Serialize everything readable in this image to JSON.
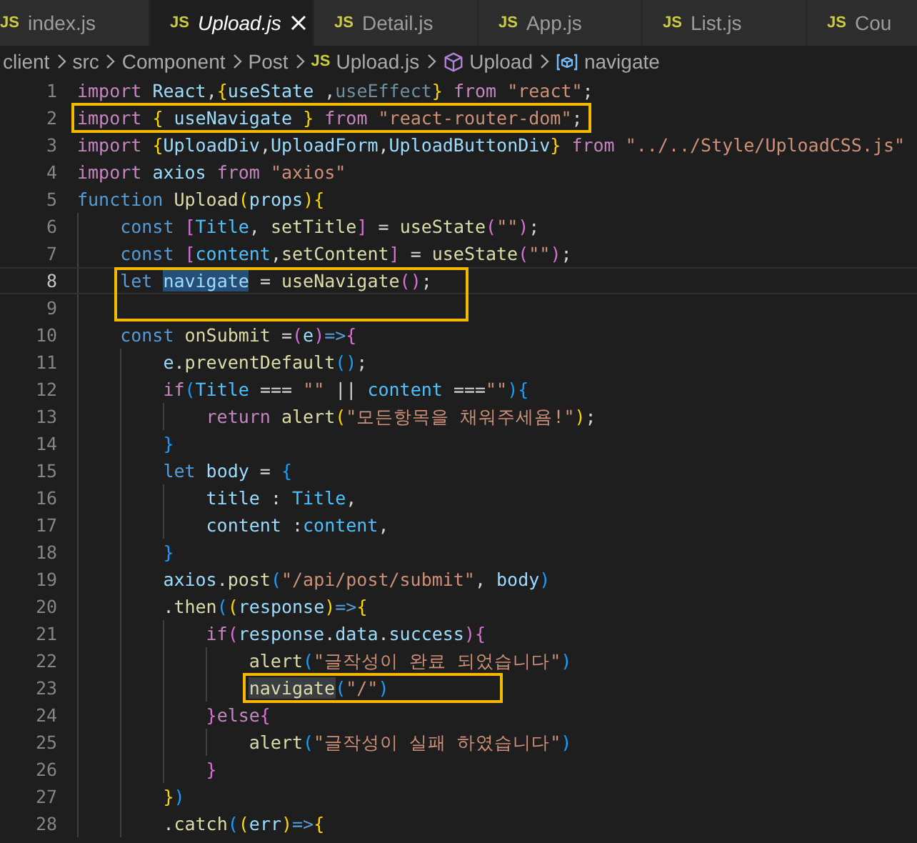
{
  "tabs": [
    {
      "icon": "JS",
      "label": "index.js",
      "selected": false,
      "preview": false
    },
    {
      "icon": "JS",
      "label": "Upload.js",
      "selected": true,
      "preview": true
    },
    {
      "icon": "JS",
      "label": "Detail.js",
      "selected": false,
      "preview": false
    },
    {
      "icon": "JS",
      "label": "App.js",
      "selected": false,
      "preview": false
    },
    {
      "icon": "JS",
      "label": "List.js",
      "selected": false,
      "preview": false
    },
    {
      "icon": "JS",
      "label": "Cou",
      "selected": false,
      "preview": false
    }
  ],
  "breadcrumbs": [
    {
      "kind": "folder",
      "label": "client"
    },
    {
      "kind": "folder",
      "label": "src"
    },
    {
      "kind": "folder",
      "label": "Component"
    },
    {
      "kind": "folder",
      "label": "Post"
    },
    {
      "kind": "file",
      "icon": "JS",
      "label": "Upload.js"
    },
    {
      "kind": "function",
      "label": "Upload"
    },
    {
      "kind": "variable",
      "label": "navigate"
    }
  ],
  "lines": [
    {
      "number": "1",
      "current": false,
      "tokens": [
        {
          "kind": "ctl",
          "text": "import "
        },
        {
          "kind": "var",
          "text": "React"
        },
        {
          "kind": "pl",
          "text": ","
        },
        {
          "kind": "b1",
          "text": "{"
        },
        {
          "kind": "var",
          "text": "useState "
        },
        {
          "kind": "pl",
          "text": ","
        },
        {
          "kind": "dim",
          "text": "useEffect"
        },
        {
          "kind": "b1",
          "text": "} "
        },
        {
          "kind": "ctl",
          "text": "from "
        },
        {
          "kind": "str",
          "text": "\"react\""
        },
        {
          "kind": "pl",
          "text": ";"
        }
      ]
    },
    {
      "number": "2",
      "current": false,
      "annotation": {
        "kind": "fit"
      },
      "tokens": [
        {
          "kind": "ctl",
          "text": "import "
        },
        {
          "kind": "b1",
          "text": "{"
        },
        {
          "kind": "var",
          "text": " useNavigate "
        },
        {
          "kind": "b1",
          "text": "} "
        },
        {
          "kind": "ctl",
          "text": "from "
        },
        {
          "kind": "str",
          "text": "\"react-router-dom\""
        },
        {
          "kind": "pl",
          "text": ";"
        }
      ]
    },
    {
      "number": "3",
      "current": false,
      "tokens": [
        {
          "kind": "ctl",
          "text": "import "
        },
        {
          "kind": "b1",
          "text": "{"
        },
        {
          "kind": "var",
          "text": "UploadDiv"
        },
        {
          "kind": "pl",
          "text": ","
        },
        {
          "kind": "var",
          "text": "UploadForm"
        },
        {
          "kind": "pl",
          "text": ","
        },
        {
          "kind": "var",
          "text": "UploadButtonDiv"
        },
        {
          "kind": "b1",
          "text": "} "
        },
        {
          "kind": "ctl",
          "text": "from "
        },
        {
          "kind": "str",
          "text": "\"../../Style/UploadCSS.js\""
        }
      ]
    },
    {
      "number": "4",
      "current": false,
      "tokens": [
        {
          "kind": "ctl",
          "text": "import "
        },
        {
          "kind": "var",
          "text": "axios "
        },
        {
          "kind": "ctl",
          "text": "from "
        },
        {
          "kind": "str",
          "text": "\"axios\""
        }
      ]
    },
    {
      "number": "5",
      "current": false,
      "tokens": [
        {
          "kind": "kw",
          "text": "function "
        },
        {
          "kind": "fn",
          "text": "Upload"
        },
        {
          "kind": "b1",
          "text": "("
        },
        {
          "kind": "var",
          "text": "props"
        },
        {
          "kind": "b1",
          "text": "){"
        }
      ]
    },
    {
      "number": "6",
      "current": false,
      "tokens": [
        {
          "kind": "kw",
          "text": "    const "
        },
        {
          "kind": "b2",
          "text": "["
        },
        {
          "kind": "cst",
          "text": "Title"
        },
        {
          "kind": "pl",
          "text": ", "
        },
        {
          "kind": "fn",
          "text": "setTitle"
        },
        {
          "kind": "b2",
          "text": "]"
        },
        {
          "kind": "pl",
          "text": " = "
        },
        {
          "kind": "fn",
          "text": "useState"
        },
        {
          "kind": "b2",
          "text": "("
        },
        {
          "kind": "str",
          "text": "\"\""
        },
        {
          "kind": "b2",
          "text": ")"
        },
        {
          "kind": "pl",
          "text": ";"
        }
      ]
    },
    {
      "number": "7",
      "current": false,
      "tokens": [
        {
          "kind": "kw",
          "text": "    const "
        },
        {
          "kind": "b2",
          "text": "["
        },
        {
          "kind": "cst",
          "text": "content"
        },
        {
          "kind": "pl",
          "text": ","
        },
        {
          "kind": "fn",
          "text": "setContent"
        },
        {
          "kind": "b2",
          "text": "]"
        },
        {
          "kind": "pl",
          "text": " = "
        },
        {
          "kind": "fn",
          "text": "useState"
        },
        {
          "kind": "b2",
          "text": "("
        },
        {
          "kind": "str",
          "text": "\"\""
        },
        {
          "kind": "b2",
          "text": ")"
        },
        {
          "kind": "pl",
          "text": ";"
        }
      ]
    },
    {
      "number": "8",
      "current": true,
      "annotation": {
        "kind": "tall"
      },
      "tokens": [
        {
          "kind": "kw",
          "text": "    let "
        },
        {
          "kind": "var",
          "text": "navigate",
          "selected": true
        },
        {
          "kind": "pl",
          "text": " = "
        },
        {
          "kind": "fn",
          "text": "useNavigate"
        },
        {
          "kind": "b2",
          "text": "()"
        },
        {
          "kind": "pl",
          "text": ";"
        }
      ]
    },
    {
      "number": "9",
      "current": false
    },
    {
      "number": "10",
      "current": false,
      "tokens": [
        {
          "kind": "kw",
          "text": "    const "
        },
        {
          "kind": "fn",
          "text": "onSubmit "
        },
        {
          "kind": "pl",
          "text": "="
        },
        {
          "kind": "b2",
          "text": "("
        },
        {
          "kind": "var",
          "text": "e"
        },
        {
          "kind": "b2",
          "text": ")"
        },
        {
          "kind": "kw",
          "text": "=>"
        },
        {
          "kind": "b2",
          "text": "{"
        }
      ]
    },
    {
      "number": "11",
      "current": false,
      "tokens": [
        {
          "kind": "var",
          "text": "        e"
        },
        {
          "kind": "pl",
          "text": "."
        },
        {
          "kind": "fn",
          "text": "preventDefault"
        },
        {
          "kind": "b3",
          "text": "()"
        },
        {
          "kind": "pl",
          "text": ";"
        }
      ]
    },
    {
      "number": "12",
      "current": false,
      "tokens": [
        {
          "kind": "ctl",
          "text": "        if"
        },
        {
          "kind": "b3",
          "text": "("
        },
        {
          "kind": "cst",
          "text": "Title"
        },
        {
          "kind": "pl",
          "text": " === "
        },
        {
          "kind": "str",
          "text": "\"\""
        },
        {
          "kind": "pl",
          "text": " || "
        },
        {
          "kind": "cst",
          "text": "content"
        },
        {
          "kind": "pl",
          "text": " ==="
        },
        {
          "kind": "str",
          "text": "\"\""
        },
        {
          "kind": "b3",
          "text": "){"
        }
      ]
    },
    {
      "number": "13",
      "current": false,
      "tokens": [
        {
          "kind": "ctl",
          "text": "            return "
        },
        {
          "kind": "fn",
          "text": "alert"
        },
        {
          "kind": "b1",
          "text": "("
        },
        {
          "kind": "str",
          "text": "\"모든항목을 채워주세욤!\""
        },
        {
          "kind": "b1",
          "text": ")"
        },
        {
          "kind": "pl",
          "text": ";"
        }
      ]
    },
    {
      "number": "14",
      "current": false,
      "tokens": [
        {
          "kind": "b3",
          "text": "        }"
        }
      ]
    },
    {
      "number": "15",
      "current": false,
      "tokens": [
        {
          "kind": "kw",
          "text": "        let "
        },
        {
          "kind": "var",
          "text": "body"
        },
        {
          "kind": "pl",
          "text": " = "
        },
        {
          "kind": "b3",
          "text": "{"
        }
      ]
    },
    {
      "number": "16",
      "current": false,
      "tokens": [
        {
          "kind": "var",
          "text": "            title"
        },
        {
          "kind": "pl",
          "text": " : "
        },
        {
          "kind": "cst",
          "text": "Title"
        },
        {
          "kind": "pl",
          "text": ","
        }
      ]
    },
    {
      "number": "17",
      "current": false,
      "tokens": [
        {
          "kind": "var",
          "text": "            content"
        },
        {
          "kind": "pl",
          "text": " :"
        },
        {
          "kind": "cst",
          "text": "content"
        },
        {
          "kind": "pl",
          "text": ","
        }
      ]
    },
    {
      "number": "18",
      "current": false,
      "tokens": [
        {
          "kind": "b3",
          "text": "        }"
        }
      ]
    },
    {
      "number": "19",
      "current": false,
      "tokens": [
        {
          "kind": "var",
          "text": "        axios"
        },
        {
          "kind": "pl",
          "text": "."
        },
        {
          "kind": "fn",
          "text": "post"
        },
        {
          "kind": "b3",
          "text": "("
        },
        {
          "kind": "str",
          "text": "\"/api/post/submit\""
        },
        {
          "kind": "pl",
          "text": ", "
        },
        {
          "kind": "var",
          "text": "body"
        },
        {
          "kind": "b3",
          "text": ")"
        }
      ]
    },
    {
      "number": "20",
      "current": false,
      "tokens": [
        {
          "kind": "pl",
          "text": "        ."
        },
        {
          "kind": "fn",
          "text": "then"
        },
        {
          "kind": "b3",
          "text": "("
        },
        {
          "kind": "b1",
          "text": "("
        },
        {
          "kind": "var",
          "text": "response"
        },
        {
          "kind": "b1",
          "text": ")"
        },
        {
          "kind": "kw",
          "text": "=>"
        },
        {
          "kind": "b1",
          "text": "{"
        }
      ]
    },
    {
      "number": "21",
      "current": false,
      "tokens": [
        {
          "kind": "ctl",
          "text": "            if"
        },
        {
          "kind": "b2",
          "text": "("
        },
        {
          "kind": "var",
          "text": "response"
        },
        {
          "kind": "pl",
          "text": "."
        },
        {
          "kind": "var",
          "text": "data"
        },
        {
          "kind": "pl",
          "text": "."
        },
        {
          "kind": "var",
          "text": "success"
        },
        {
          "kind": "b2",
          "text": "){"
        }
      ]
    },
    {
      "number": "22",
      "current": false,
      "tokens": [
        {
          "kind": "fn",
          "text": "                alert"
        },
        {
          "kind": "b3",
          "text": "("
        },
        {
          "kind": "str",
          "text": "\"글작성이 완료 되었습니다\""
        },
        {
          "kind": "b3",
          "text": ")"
        }
      ]
    },
    {
      "number": "23",
      "current": false,
      "annotation": {
        "kind": "wide"
      },
      "tokens": [
        {
          "kind": "fn",
          "text": "                navigate",
          "highlighted": true
        },
        {
          "kind": "b3",
          "text": "("
        },
        {
          "kind": "str",
          "text": "\"/\""
        },
        {
          "kind": "b3",
          "text": ")"
        }
      ]
    },
    {
      "number": "24",
      "current": false,
      "tokens": [
        {
          "kind": "b2",
          "text": "            }"
        },
        {
          "kind": "ctl",
          "text": "else"
        },
        {
          "kind": "b2",
          "text": "{"
        }
      ]
    },
    {
      "number": "25",
      "current": false,
      "tokens": [
        {
          "kind": "fn",
          "text": "                alert"
        },
        {
          "kind": "b3",
          "text": "("
        },
        {
          "kind": "str",
          "text": "\"글작성이 실패 하였습니다\""
        },
        {
          "kind": "b3",
          "text": ")"
        }
      ]
    },
    {
      "number": "26",
      "current": false,
      "tokens": [
        {
          "kind": "b2",
          "text": "            }"
        }
      ]
    },
    {
      "number": "27",
      "current": false,
      "tokens": [
        {
          "kind": "b1",
          "text": "        }"
        },
        {
          "kind": "b3",
          "text": ")"
        }
      ]
    },
    {
      "number": "28",
      "current": false,
      "tokens": [
        {
          "kind": "pl",
          "text": "        ."
        },
        {
          "kind": "fn",
          "text": "catch"
        },
        {
          "kind": "b3",
          "text": "("
        },
        {
          "kind": "b1",
          "text": "("
        },
        {
          "kind": "var",
          "text": "err"
        },
        {
          "kind": "b1",
          "text": ")"
        },
        {
          "kind": "kw",
          "text": "=>"
        },
        {
          "kind": "b1",
          "text": "{"
        }
      ]
    }
  ]
}
